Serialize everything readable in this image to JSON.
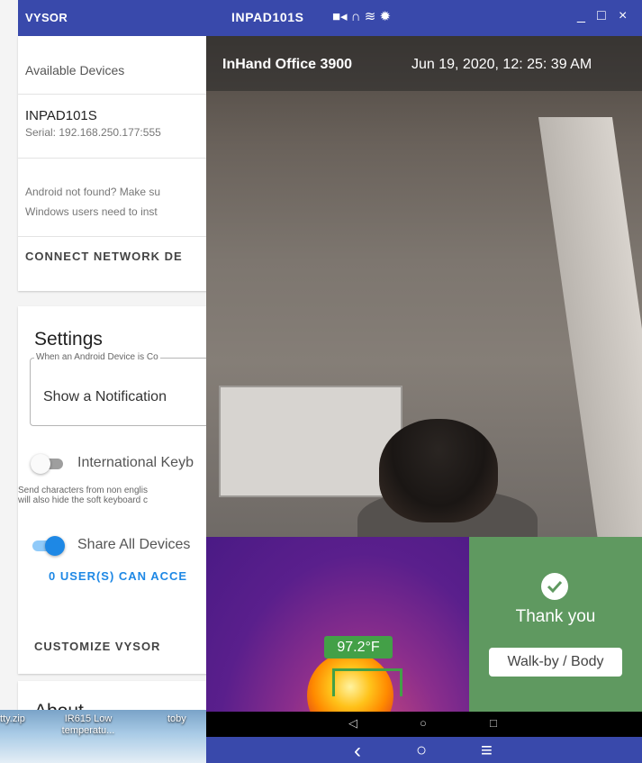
{
  "vysor": {
    "app_name": "VYSOR",
    "available_devices_label": "Available Devices",
    "device": {
      "name": "INPAD101S",
      "serial": "Serial: 192.168.250.177:555"
    },
    "help_line1": "Android not found? Make su",
    "help_line2": "Windows users need to inst",
    "connect_network_label": "CONNECT NETWORK DE",
    "settings": {
      "title": "Settings",
      "when_label": "When an Android Device is Co",
      "when_value": "Show a Notification",
      "intl_keyboard_label": "International Keyb",
      "intl_keyboard_on": false,
      "intl_desc_line1": "Send characters from non englis",
      "intl_desc_line2": "will also hide the soft keyboard c",
      "share_label": "Share All Devices",
      "share_on": true,
      "users_link": "0 USER(S) CAN ACCE",
      "customize_label": "CUSTOMIZE VYSOR"
    },
    "about_label": "About"
  },
  "desktop_icons": [
    {
      "label": "tty.zip"
    },
    {
      "label": "IR615 Low temperatu..."
    },
    {
      "label": "toby"
    }
  ],
  "device_window": {
    "title": "INPAD101S",
    "status_icons": [
      "video-icon",
      "headset-icon",
      "wifi-icon",
      "gear-icon"
    ],
    "minimize": "_",
    "maximize": "□",
    "close": "×"
  },
  "screen": {
    "location": "InHand Office 3900",
    "datetime": "Jun 19, 2020, 12: 25: 39 AM",
    "temperature": "97.2°F",
    "result_text": "Thank you",
    "mode_text": "Walk-by / Body"
  },
  "android_nav": {
    "back": "◁",
    "home": "○",
    "recents": "□"
  },
  "vysor_nav": {
    "back": "‹",
    "home": "○",
    "menu": "≡"
  },
  "colors": {
    "vysor_blue": "#3949ab",
    "accent_blue": "#1e88e5",
    "result_green": "#5f9960",
    "temp_green": "#43a047"
  }
}
